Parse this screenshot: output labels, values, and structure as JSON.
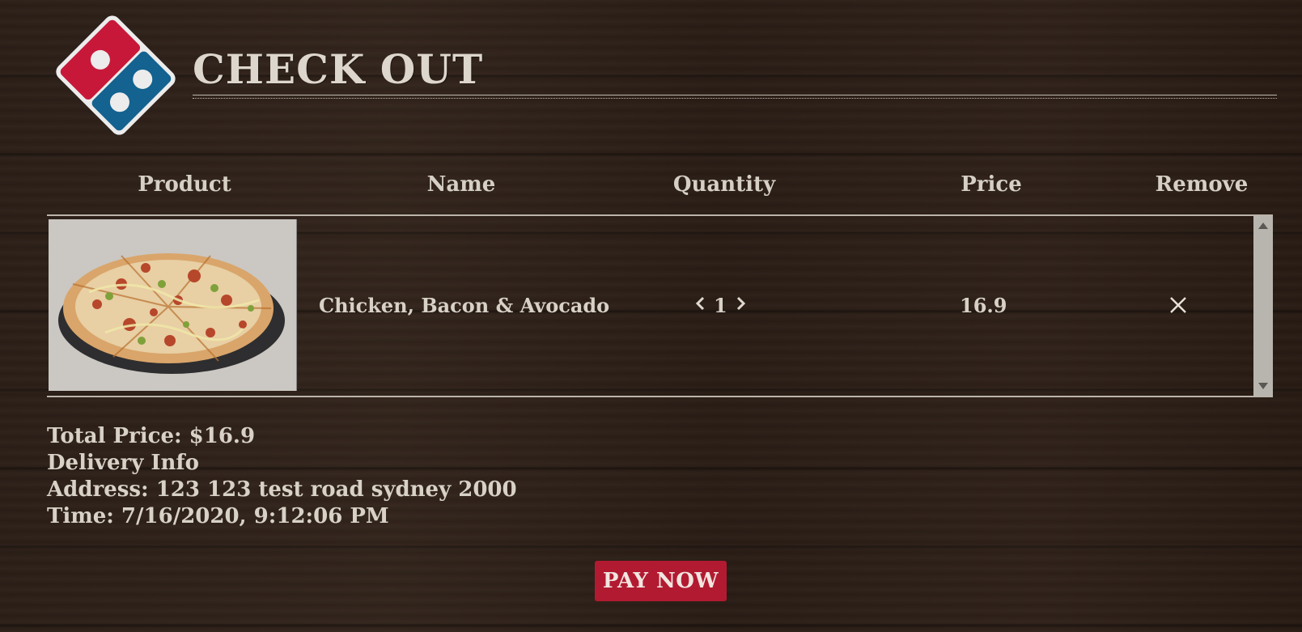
{
  "header": {
    "title": "CHECK OUT"
  },
  "brand": {
    "logo": "dominos-logo",
    "colors": {
      "red": "#c8183a",
      "blue": "#13628f",
      "tile_border": "#eaeaea"
    }
  },
  "table": {
    "headers": [
      "Product",
      "Name",
      "Quantity",
      "Price",
      "Remove"
    ],
    "rows": [
      {
        "image": "pizza-image",
        "name": "Chicken, Bacon & Avocado",
        "quantity": "1",
        "price": "16.9",
        "remove_icon": "close-icon"
      }
    ]
  },
  "summary": {
    "total": "Total Price: $16.9",
    "delivery_heading": "Delivery Info",
    "address": "Address: 123 123 test road sydney 2000",
    "time": "Time: 7/16/2020, 9:12:06 PM"
  },
  "actions": {
    "pay_label": "PAY NOW",
    "pay_color": "#b21a31"
  }
}
